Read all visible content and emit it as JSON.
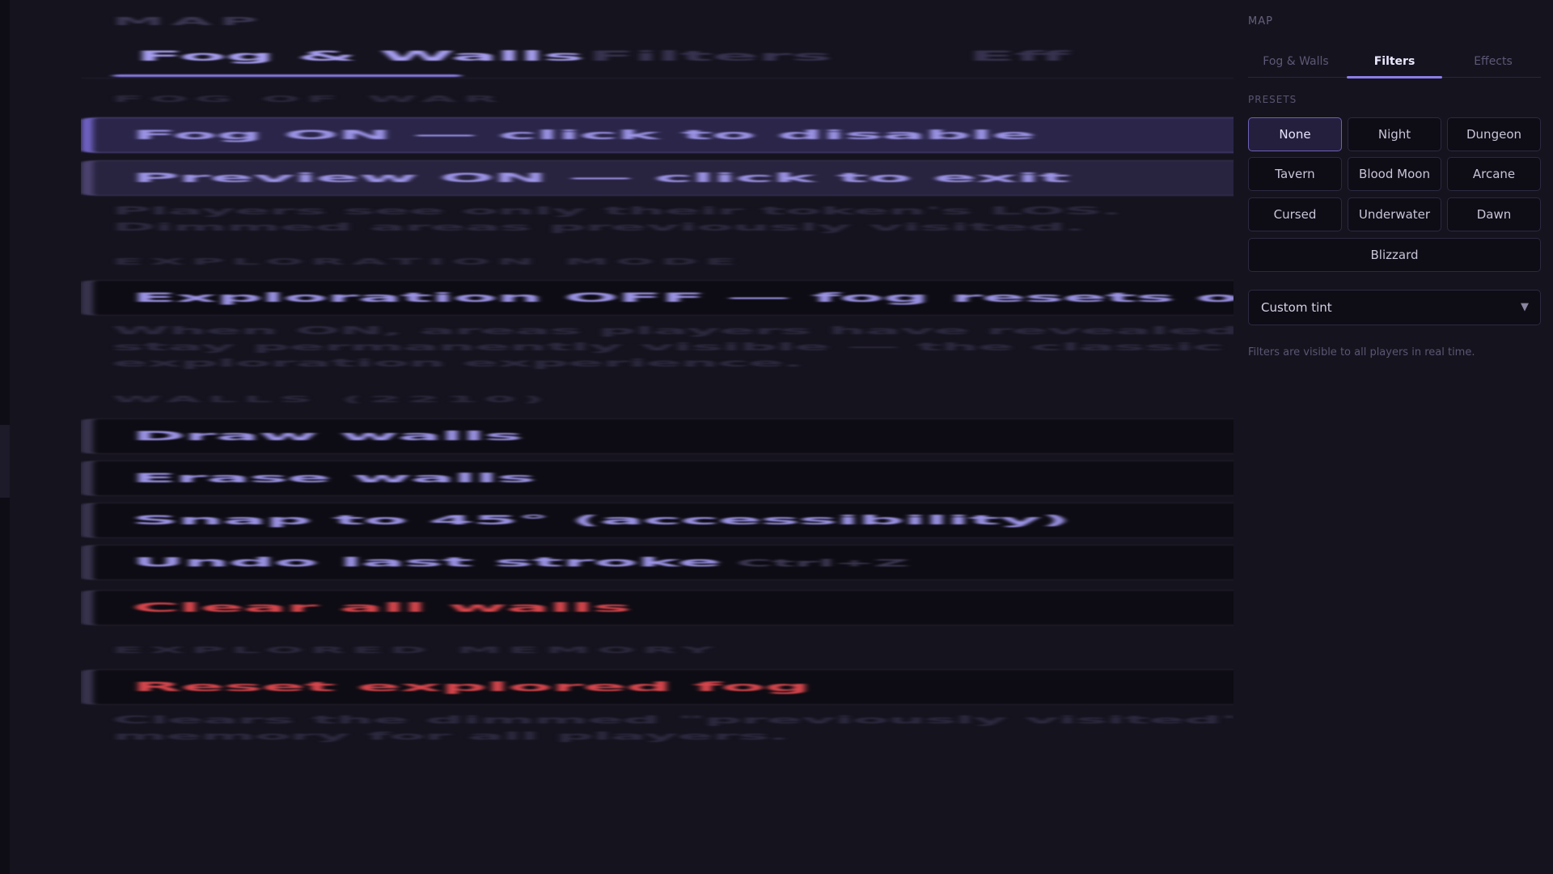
{
  "background": {
    "title": "MAP",
    "tabs": [
      "Fog & Walls",
      "Filters",
      "Eff"
    ],
    "sections": {
      "fog": "FOG OF WAR",
      "exploration": "EXPLORATION MODE",
      "walls": "WALLS (2210)",
      "memory": "EXPLORED MEMORY"
    },
    "fog_toggle": "Fog ON — click to disable",
    "preview_toggle": "Preview ON — click to exit",
    "fog_note": "Players see only their token's LOS. Dimmed areas previously visited.",
    "exploration_toggle": "Exploration OFF — fog resets on move",
    "exploration_note": "When ON, areas players have revealed stay permanently visible — the classic exploration experience.",
    "walls": {
      "draw": "Draw walls",
      "erase": "Erase walls",
      "snap": "Snap to 45° (accessibility)",
      "undo": "Undo last stroke",
      "undo_shortcut": "Ctrl+Z",
      "clear": "Clear all walls"
    },
    "reset_fog": "Reset explored fog",
    "memory_note": "Clears the dimmed \"previously visited\" memory for all players."
  },
  "panel": {
    "title": "MAP",
    "tabs": [
      "Fog & Walls",
      "Filters",
      "Effects"
    ],
    "active_tab": "Filters",
    "presets_label": "PRESETS",
    "presets": [
      "None",
      "Night",
      "Dungeon",
      "Tavern",
      "Blood Moon",
      "Arcane",
      "Cursed",
      "Underwater",
      "Dawn",
      "Blizzard"
    ],
    "active_preset": "None",
    "custom_tint": "Custom tint",
    "dropdown_icon": "triangle-down-icon",
    "note": "Filters are visible to all players in real time."
  },
  "colors": {
    "accent": "#8b7ee8",
    "danger": "#d8464c",
    "background": "#15131e"
  }
}
